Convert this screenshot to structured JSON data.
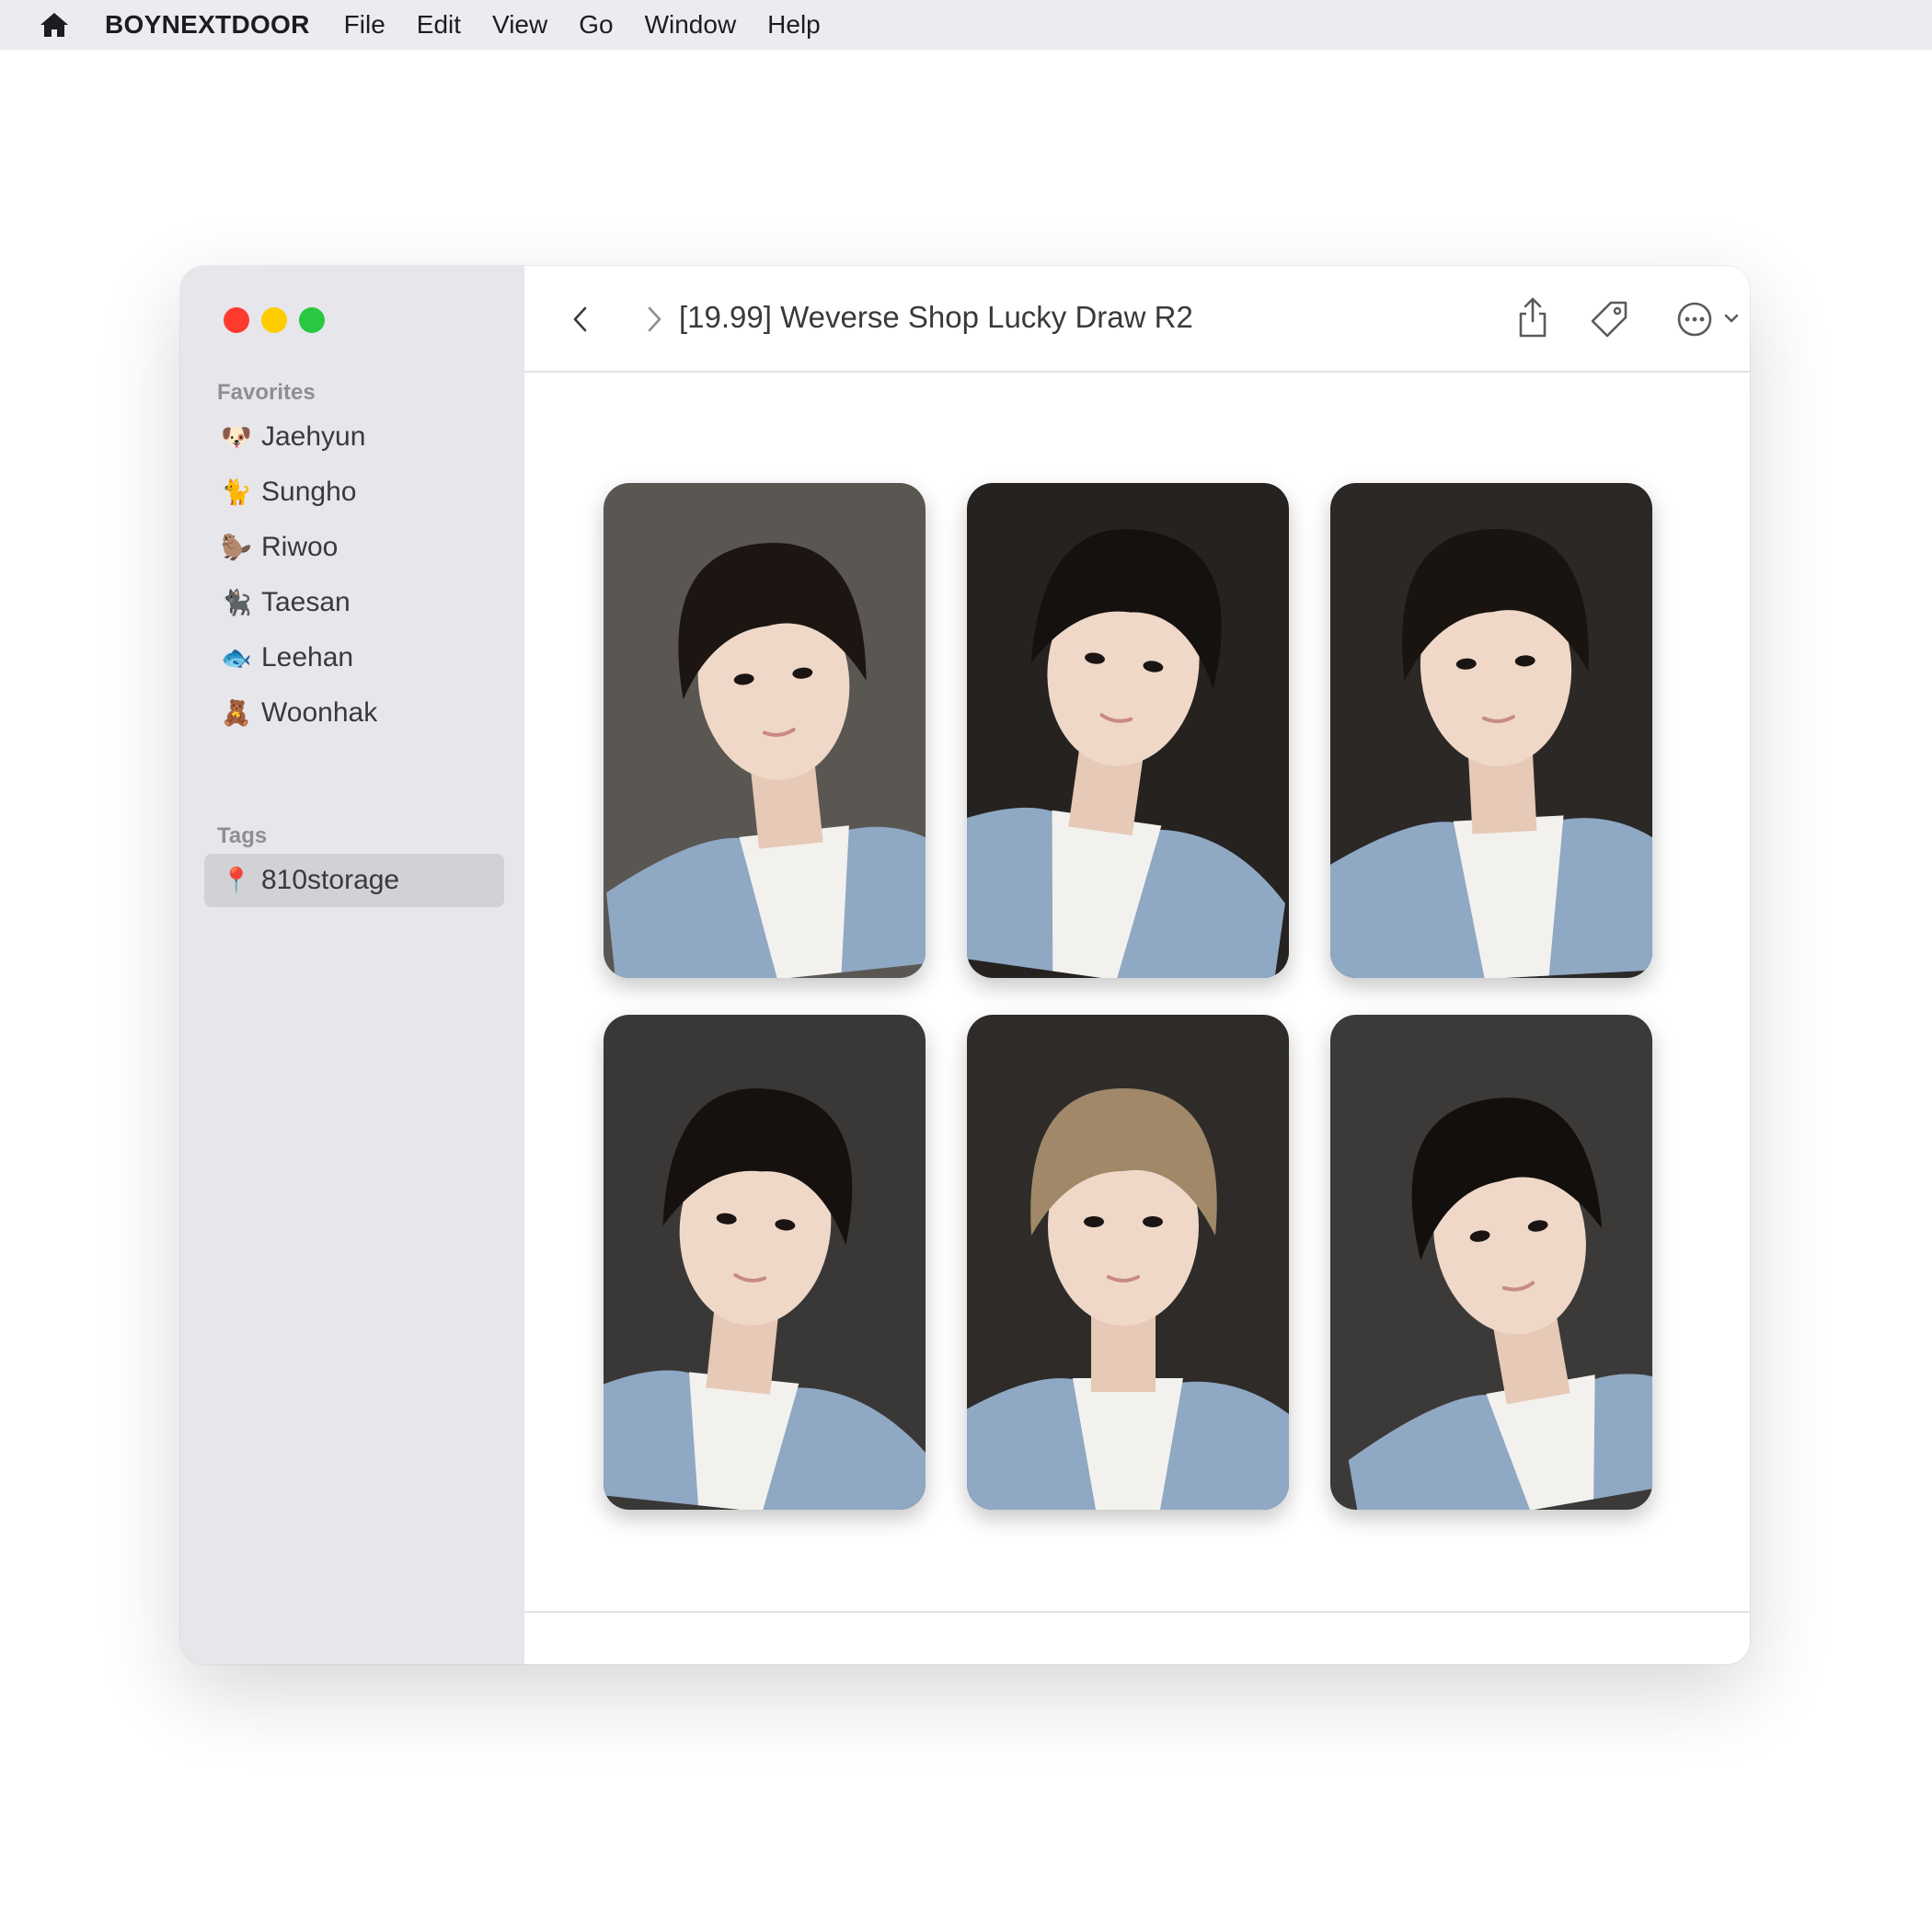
{
  "menubar": {
    "app_name": "BOYNEXTDOOR",
    "items": [
      "File",
      "Edit",
      "View",
      "Go",
      "Window",
      "Help"
    ]
  },
  "sidebar": {
    "favorites_label": "Favorites",
    "favorites": [
      {
        "emoji": "🐶",
        "label": "Jaehyun"
      },
      {
        "emoji": "🐈",
        "label": "Sungho"
      },
      {
        "emoji": "🦫",
        "label": "Riwoo"
      },
      {
        "emoji": "🐈‍⬛",
        "label": "Taesan"
      },
      {
        "emoji": "🐟",
        "label": "Leehan"
      },
      {
        "emoji": "🧸",
        "label": "Woonhak"
      }
    ],
    "tags_label": "Tags",
    "tags": [
      {
        "emoji": "📍",
        "label": "810storage"
      }
    ]
  },
  "toolbar": {
    "title": "[19.99] Weverse Shop Lucky Draw R2",
    "icons": [
      "chevron-left-icon",
      "chevron-right-icon",
      "share-icon",
      "tag-icon",
      "ellipsis-circle-icon",
      "chevron-down-icon",
      "search-icon"
    ]
  },
  "photos": [
    {
      "hair": "#1c1512",
      "bg": "#5a5652"
    },
    {
      "hair": "#15110f",
      "bg": "#262220"
    },
    {
      "hair": "#1a1410",
      "bg": "#2c2826"
    },
    {
      "hair": "#16110e",
      "bg": "#3a3836"
    },
    {
      "hair": "#a08868",
      "bg": "#2e2b29"
    },
    {
      "hair": "#130f0d",
      "bg": "#3c3a38"
    }
  ],
  "colors": {
    "menubar_bg": "#ebebf0",
    "sidebar_bg": "#e6e6eb",
    "tag_selected_bg": "#d1d1d6",
    "jacket": "#8fa8c4",
    "traffic_red": "#ff3b30",
    "traffic_yellow": "#ffcc00",
    "traffic_green": "#28c840"
  }
}
